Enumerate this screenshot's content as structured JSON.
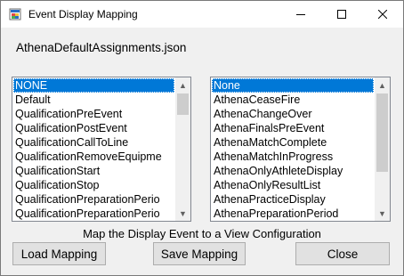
{
  "window": {
    "title": "Event Display Mapping"
  },
  "titlebar_buttons": {
    "minimize": "—",
    "maximize": "☐",
    "close": "✕"
  },
  "file_label": "AthenaDefaultAssignments.json",
  "display_events": {
    "items": [
      "NONE",
      "Default",
      "QualificationPreEvent",
      "QualificationPostEvent",
      "QualificationCallToLine",
      "QualificationRemoveEquipme",
      "QualificationStart",
      "QualificationStop",
      "QualificationPreparationPerio",
      "QualificationPreparationPerio"
    ],
    "selected": "NONE"
  },
  "view_configurations": {
    "items": [
      "None",
      "AthenaCeaseFire",
      "AthenaChangeOver",
      "AthenaFinalsPreEvent",
      "AthenaMatchComplete",
      "AthenaMatchInProgress",
      "AthenaOnlyAthleteDisplay",
      "AthenaOnlyResultList",
      "AthenaPracticeDisplay",
      "AthenaPreparationPeriod"
    ],
    "selected": "None"
  },
  "instruction": "Map the Display Event to a View Configuration",
  "buttons": {
    "load": "Load Mapping",
    "save": "Save Mapping",
    "close": "Close"
  },
  "icons": {
    "app": "app-window-icon",
    "scroll_up": "▲",
    "scroll_down": "▼"
  },
  "colors": {
    "selection": "#0078d7",
    "window_bg": "#f0f0f0",
    "button_bg": "#e1e1e1"
  }
}
